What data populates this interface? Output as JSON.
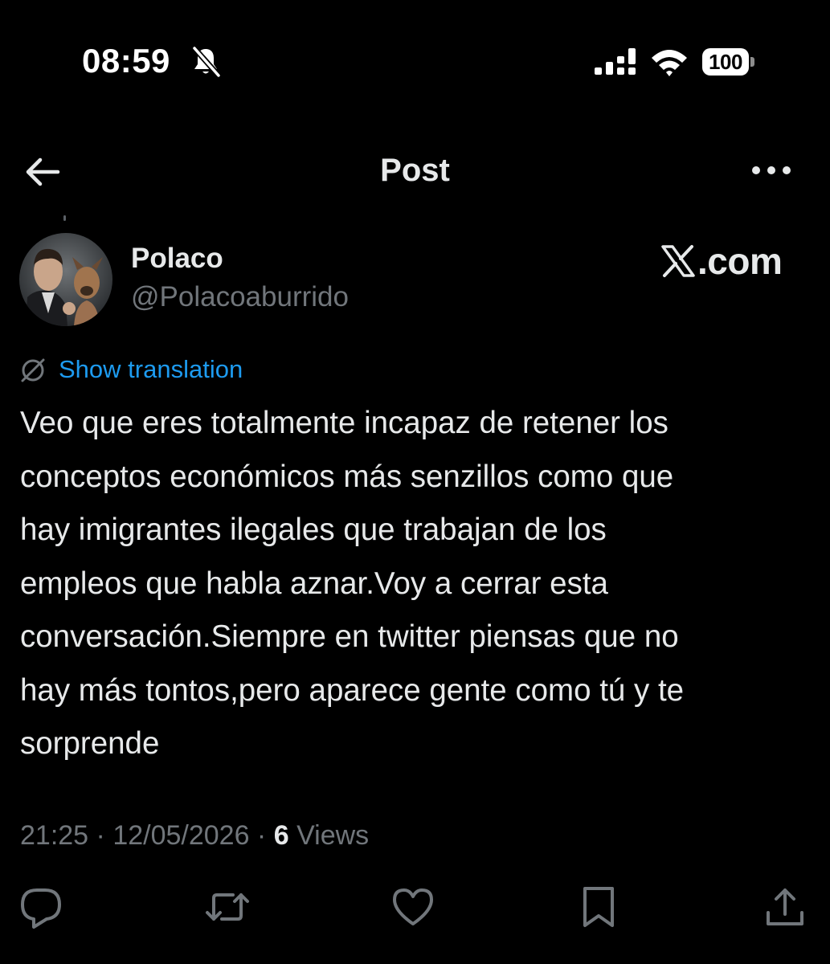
{
  "status_bar": {
    "time": "08:59",
    "battery": "100",
    "icons": [
      "bell-slash-icon",
      "signal-icon",
      "wifi-icon",
      "battery-icon"
    ]
  },
  "nav": {
    "title": "Post",
    "back_icon": "arrow-left-icon",
    "more_icon": "more-horizontal-icon"
  },
  "author": {
    "display_name": "Polaco",
    "handle": "@Polacoaburrido",
    "avatar_icon": "avatar-image"
  },
  "watermark": {
    "logo": "x-logo-icon",
    "text": ".com"
  },
  "translation": {
    "icon": "globe-slash-icon",
    "label": "Show translation"
  },
  "post": {
    "text": "Veo que eres totalmente incapaz de retener los\nconceptos económicos más senzillos como que\nhay imigrantes ilegales que trabajan de los\nempleos que habla aznar.Voy a cerrar esta\nconversación.Siempre en twitter piensas que no\nhay más tontos,pero aparece gente como tú y te\nsorprende"
  },
  "meta": {
    "time": "21:25",
    "separator": " · ",
    "date": "12/05/2026",
    "views_count": "6",
    "views_label": "Views"
  },
  "actions": [
    {
      "name": "reply",
      "icon": "comment-icon"
    },
    {
      "name": "repost",
      "icon": "repost-icon"
    },
    {
      "name": "like",
      "icon": "heart-icon"
    },
    {
      "name": "bookmark",
      "icon": "bookmark-icon"
    },
    {
      "name": "share",
      "icon": "share-icon"
    }
  ],
  "colors": {
    "background": "#000000",
    "text_primary": "#e7e9ea",
    "text_secondary": "#71767b",
    "link": "#1d9bf0"
  }
}
